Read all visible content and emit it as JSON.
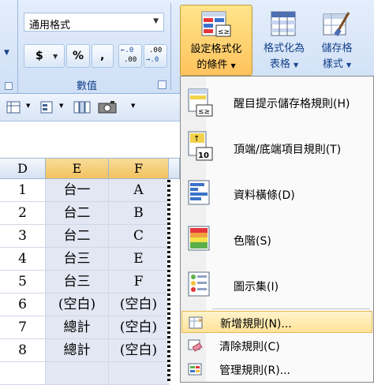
{
  "ribbon": {
    "number_format_value": "通用格式",
    "currency_symbol": "$",
    "percent_symbol": "%",
    "comma_symbol": ",",
    "increase_decimal_top": "←.0",
    "increase_decimal_bottom": ".00",
    "decrease_decimal_top": ".00",
    "decrease_decimal_bottom": "→.0",
    "number_group_label": "數值",
    "conditional_format_label_1": "設定格式化",
    "conditional_format_label_2": "的條件",
    "format_as_table_label_1": "格式化為",
    "format_as_table_label_2": "表格",
    "cell_styles_label_1": "儲存格",
    "cell_styles_label_2": "樣式"
  },
  "sheet": {
    "columns": [
      "D",
      "E",
      "F"
    ],
    "rows": [
      [
        "1",
        "台一",
        "A"
      ],
      [
        "2",
        "台二",
        "B"
      ],
      [
        "3",
        "台二",
        "C"
      ],
      [
        "4",
        "台三",
        "E"
      ],
      [
        "5",
        "台三",
        "F"
      ],
      [
        "6",
        "(空白)",
        "(空白)"
      ],
      [
        "7",
        "總計",
        "(空白)"
      ],
      [
        "8",
        "總計",
        "(空白)"
      ]
    ]
  },
  "menu": {
    "items": [
      {
        "label": "醒目提示儲存格規則(H)",
        "icon": "highlight-rules-icon"
      },
      {
        "label": "頂端/底端項目規則(T)",
        "icon": "top-bottom-rules-icon"
      },
      {
        "label": "資料橫條(D)",
        "icon": "data-bars-icon"
      },
      {
        "label": "色階(S)",
        "icon": "color-scales-icon"
      },
      {
        "label": "圖示集(I)",
        "icon": "icon-sets-icon"
      },
      {
        "label": "新增規則(N)...",
        "icon": "new-rule-icon"
      },
      {
        "label": "清除規則(C)",
        "icon": "clear-rules-icon"
      },
      {
        "label": "管理規則(R)...",
        "icon": "manage-rules-icon"
      }
    ]
  }
}
